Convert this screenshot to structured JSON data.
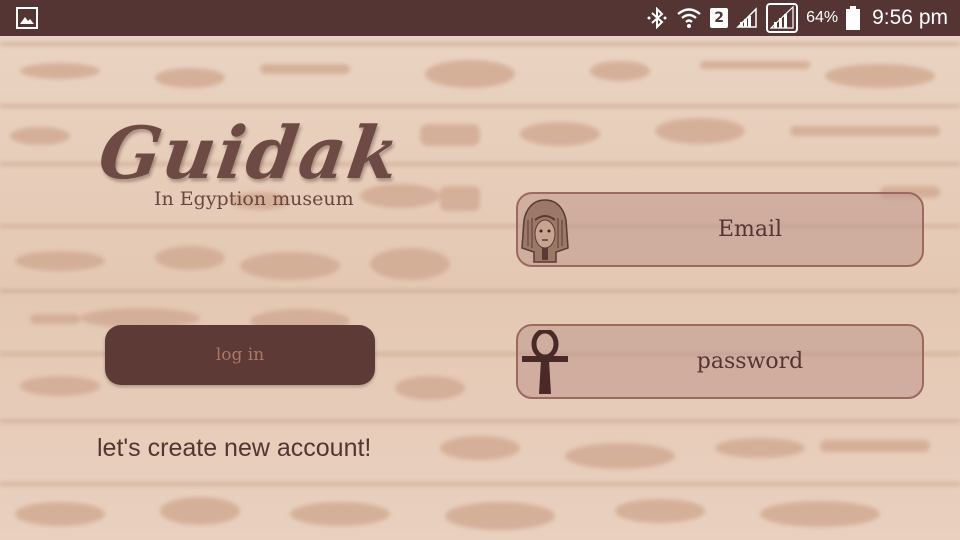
{
  "status_bar": {
    "battery_percent": "64%",
    "time": "9:56 pm",
    "sim_slot": "2",
    "icons": [
      "gallery-notification-icon",
      "bluetooth-icon",
      "wifi-icon",
      "signal-icon",
      "signal-icon",
      "battery-icon"
    ]
  },
  "logo": {
    "title": "Guidak",
    "subtitle": "In Egyption museum"
  },
  "form": {
    "email_placeholder": "Email",
    "password_placeholder": "password",
    "email_icon": "pharaoh-icon",
    "password_icon": "ankh-icon"
  },
  "login_label": "log in",
  "create_account": "let's create new account!",
  "colors": {
    "status_bar": "#553434",
    "button": "#5e3a36",
    "text_brown": "#553434",
    "background": "#e6c9b4"
  }
}
